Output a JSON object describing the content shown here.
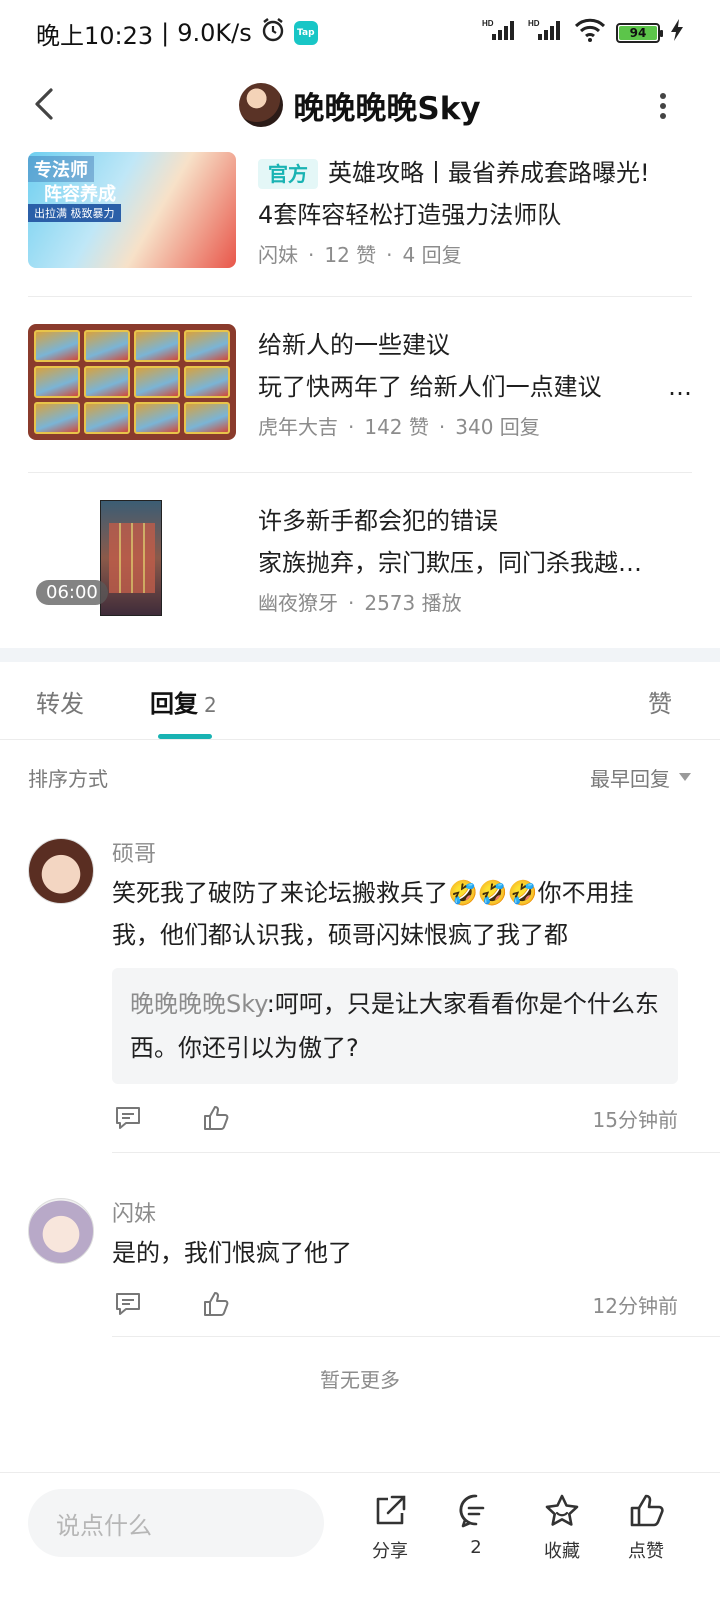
{
  "status_bar": {
    "time": "晚上10:23",
    "separator": "|",
    "network_speed": "9.0K/s",
    "battery": "94"
  },
  "nav": {
    "title": "晚晚晚晚Sky"
  },
  "posts": [
    {
      "thumb_text_1": "专法师",
      "thumb_text_2": "阵容养成",
      "thumb_text_3": "出拉满 极致暴力",
      "tag": "官方",
      "title": "英雄攻略丨最省养成套路曝光!",
      "subtitle": "4套阵容轻松打造强力法师队",
      "author": "闪妹",
      "likes": "12 赞",
      "replies": "4 回复"
    },
    {
      "title": "给新人的一些建议",
      "subtitle": "玩了快两年了 给新人们一点建议",
      "ellipsis": "…",
      "author": "虎年大吉",
      "likes": "142 赞",
      "replies": "340 回复"
    },
    {
      "duration": "06:00",
      "title": "许多新手都会犯的错误",
      "subtitle": "家族抛弃，宗门欺压，同门杀我越…",
      "author": "幽夜獠牙",
      "plays": "2573 播放"
    }
  ],
  "meta_dot": "·",
  "tabs": {
    "forward": "转发",
    "reply": "回复",
    "reply_count": "2",
    "like": "赞"
  },
  "sort": {
    "label": "排序方式",
    "value": "最早回复"
  },
  "comments": [
    {
      "name": "硕哥",
      "text": "笑死我了破防了来论坛搬救兵了🤣🤣🤣你不用挂我，他们都认识我，硕哥闪妹恨疯了我了都",
      "reply_author": "晚晚晚晚Sky",
      "reply_sep": ":",
      "reply_text": "呵呵，只是让大家看看你是个什么东西。你还引以为傲了?",
      "time": "15分钟前"
    },
    {
      "name": "闪妹",
      "text": "是的，我们恨疯了他了",
      "time": "12分钟前"
    }
  ],
  "no_more": "暂无更多",
  "bottom_bar": {
    "input_placeholder": "说点什么",
    "share": "分享",
    "comment_count": "2",
    "favorite": "收藏",
    "like": "点赞"
  },
  "colors": {
    "accent": "#19b3b3",
    "battery": "#5cc54a"
  }
}
